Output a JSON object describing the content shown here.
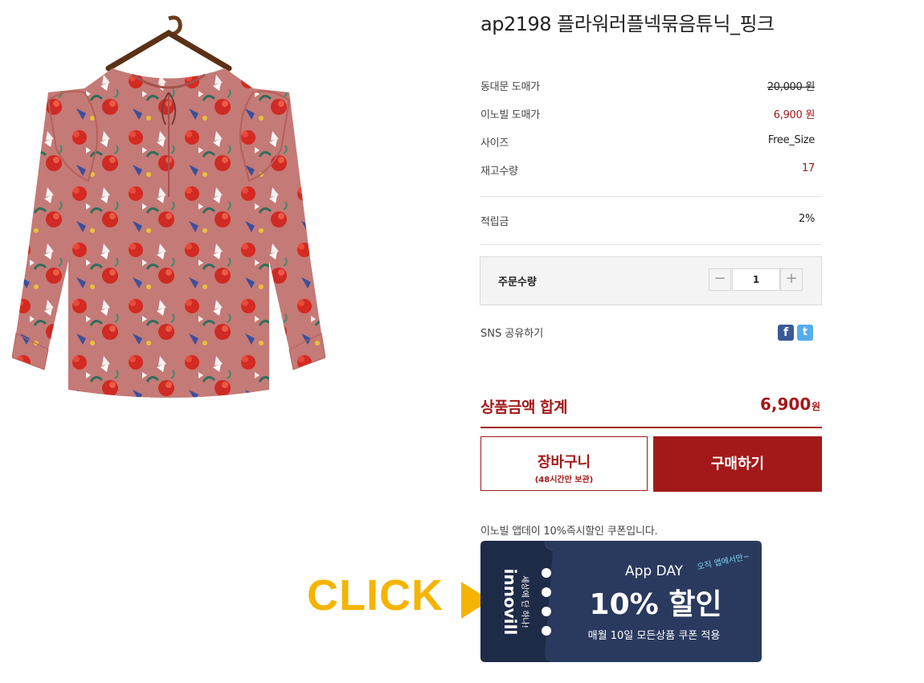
{
  "product": {
    "title": "ap2198 플라워러플넥묶음튜닉_핑크",
    "image_icon": "floral-blouse-image"
  },
  "info": {
    "market_price_label": "동대문 도매가",
    "market_price_value": "20,000 원",
    "our_price_label": "이노빌 도매가",
    "our_price_value": "6,900 원",
    "size_label": "사이즈",
    "size_value": "Free_Size",
    "stock_label": "재고수량",
    "stock_value": "17",
    "points_label": "적립금",
    "points_value": "2%"
  },
  "quantity": {
    "label": "주문수량",
    "value": "1",
    "minus_icon": "minus-icon",
    "plus_icon": "plus-icon"
  },
  "sns": {
    "label": "SNS 공유하기",
    "facebook": "f",
    "twitter": "t"
  },
  "total": {
    "label": "상품금액 합계",
    "price": "6,900",
    "unit": "원"
  },
  "buttons": {
    "cart_label": "장바구니",
    "cart_sub": "(48시간만 보관)",
    "buy_label": "구매하기"
  },
  "coupon": {
    "note": "이노빌 앱데이 10%즉시할인 쿠폰입니다.",
    "brand": "innovill",
    "brand_tagline": "세상에 단 하나!",
    "app_day": "App DAY",
    "script_note": "오직 앱에서만~",
    "discount": "10% 할인",
    "detail": "매월 10일 모든상품 쿠폰 적용"
  },
  "click_label": "CLICK",
  "colors": {
    "accent_red": "#a31919",
    "click_yellow": "#f5b400",
    "coupon_navy": "#2a3a5e",
    "coupon_navy_dark": "#1e2b47"
  }
}
